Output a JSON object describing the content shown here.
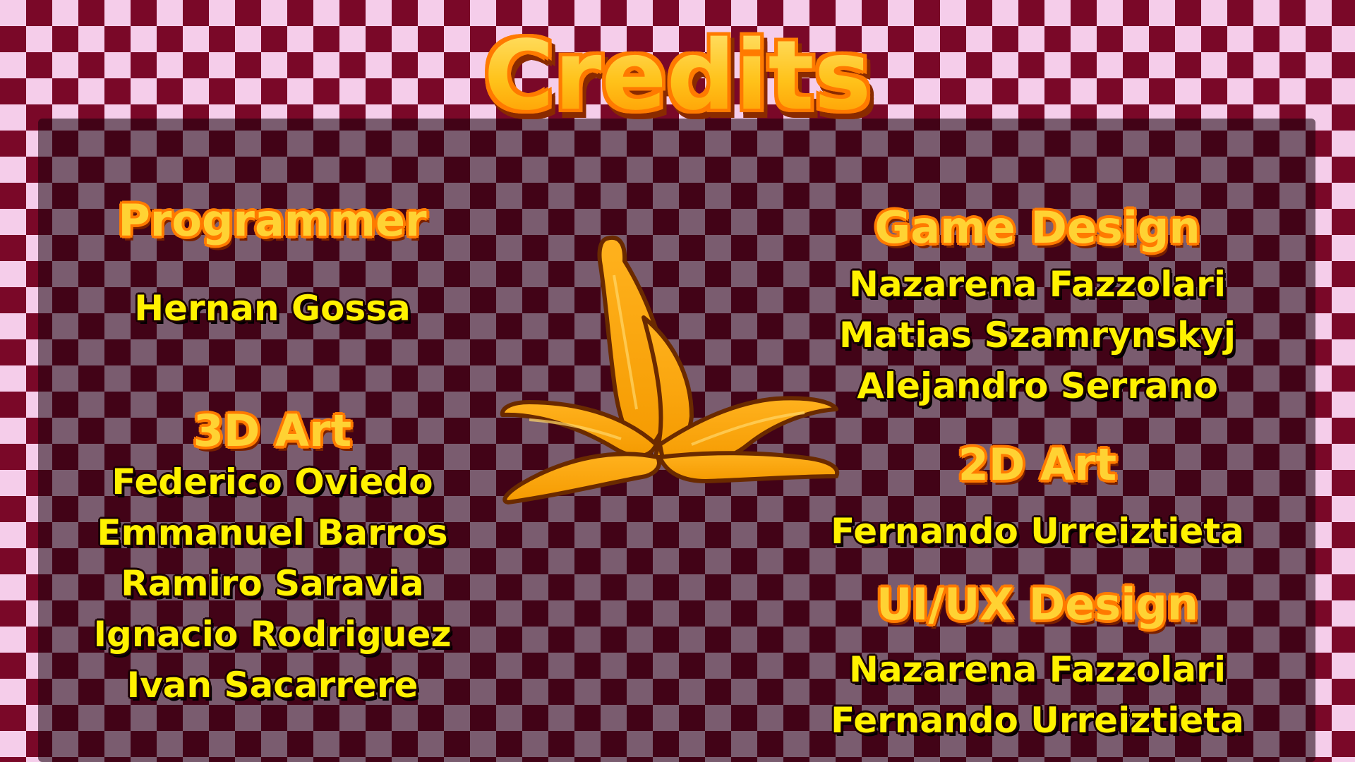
{
  "screen": {
    "title": "Credits"
  },
  "credits": {
    "programmer": {
      "heading": "Programmer",
      "names": [
        "Hernan Gossa"
      ]
    },
    "art_3d": {
      "heading": "3D Art",
      "names": [
        "Federico Oviedo",
        "Emmanuel Barros",
        "Ramiro Saravia",
        "Ignacio Rodriguez",
        "Ivan Sacarrere"
      ]
    },
    "game_design": {
      "heading": "Game Design",
      "names": [
        "Nazarena Fazzolari",
        "Matias Szamrynskyj",
        "Alejandro Serrano"
      ]
    },
    "art_2d": {
      "heading": "2D Art",
      "names": [
        "Fernando Urreiztieta"
      ]
    },
    "ui_ux": {
      "heading": "UI/UX Design",
      "names": [
        "Nazarena Fazzolari",
        "Fernando Urreiztieta"
      ]
    }
  },
  "icons": {
    "center_graphic": "banana-peel-icon"
  },
  "colors": {
    "checker_dark": "#7a0828",
    "checker_light": "#f5cdea",
    "heading_fill": "#ffd233",
    "heading_outline": "#ff7a00",
    "name_fill": "#fff200"
  }
}
